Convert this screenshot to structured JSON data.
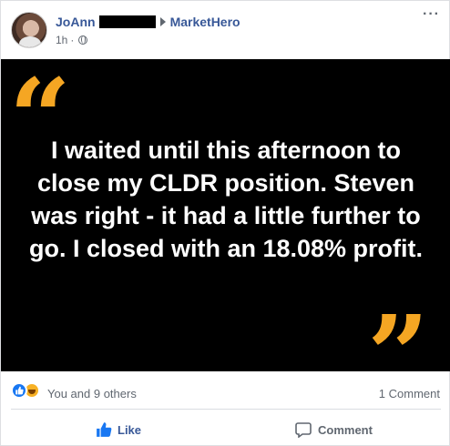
{
  "post": {
    "author": "JoAnn",
    "group": "MarketHero",
    "timestamp": "1h",
    "separator": "·",
    "quote_text": "I waited until this afternoon to close my CLDR position. Steven was right - it had a little further to go. I closed with an 18.08% profit.",
    "quote_open": "“",
    "quote_close": "”",
    "accent_color": "#f5a623"
  },
  "reactions": {
    "summary": "You and 9 others",
    "comments": "1 Comment",
    "icons": [
      "like-reaction-icon",
      "haha-reaction-icon"
    ]
  },
  "actions": {
    "like_label": "Like",
    "comment_label": "Comment"
  },
  "icons": {
    "more": "more-options-icon",
    "audience": "globe-icon",
    "arrow": "arrow-right-icon"
  }
}
